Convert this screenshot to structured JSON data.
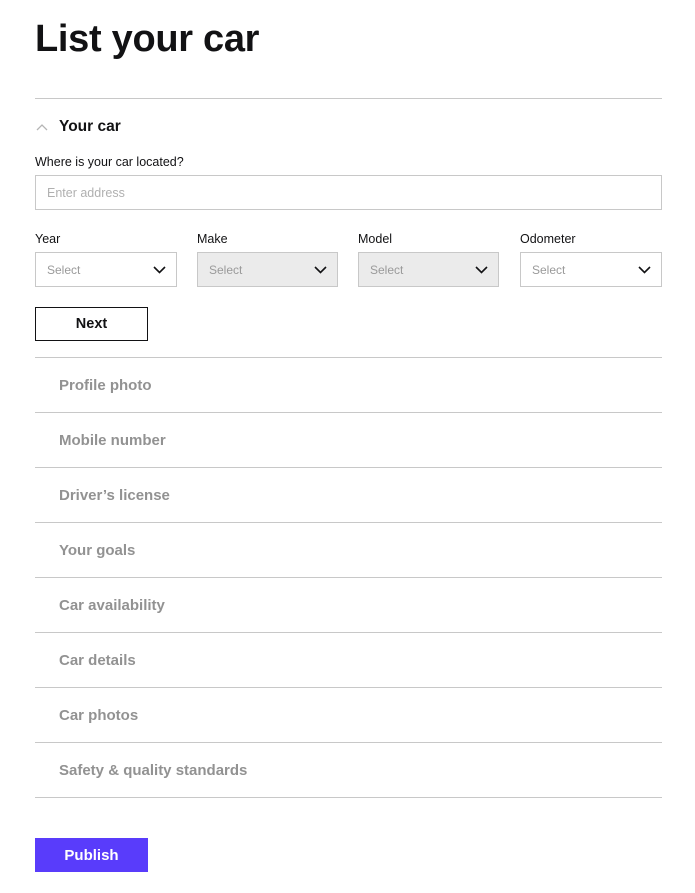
{
  "page": {
    "title": "List your car"
  },
  "section": {
    "title": "Your car",
    "expanded": true,
    "address": {
      "label": "Where is your car located?",
      "placeholder": "Enter address",
      "value": ""
    },
    "selects": [
      {
        "label": "Year",
        "value": "Select",
        "disabled": false
      },
      {
        "label": "Make",
        "value": "Select",
        "disabled": true
      },
      {
        "label": "Model",
        "value": "Select",
        "disabled": true
      },
      {
        "label": "Odometer",
        "value": "Select",
        "disabled": false
      }
    ],
    "next_label": "Next"
  },
  "steps": [
    {
      "label": "Profile photo"
    },
    {
      "label": "Mobile number"
    },
    {
      "label": "Driver’s license"
    },
    {
      "label": "Your goals"
    },
    {
      "label": "Car availability"
    },
    {
      "label": "Car details"
    },
    {
      "label": "Car photos"
    },
    {
      "label": "Safety & quality standards"
    }
  ],
  "publish_label": "Publish",
  "colors": {
    "accent": "#593cfb",
    "text": "#121214",
    "muted": "#929292",
    "divider": "#c8c8c8",
    "disabled_bg": "#ebebeb"
  }
}
